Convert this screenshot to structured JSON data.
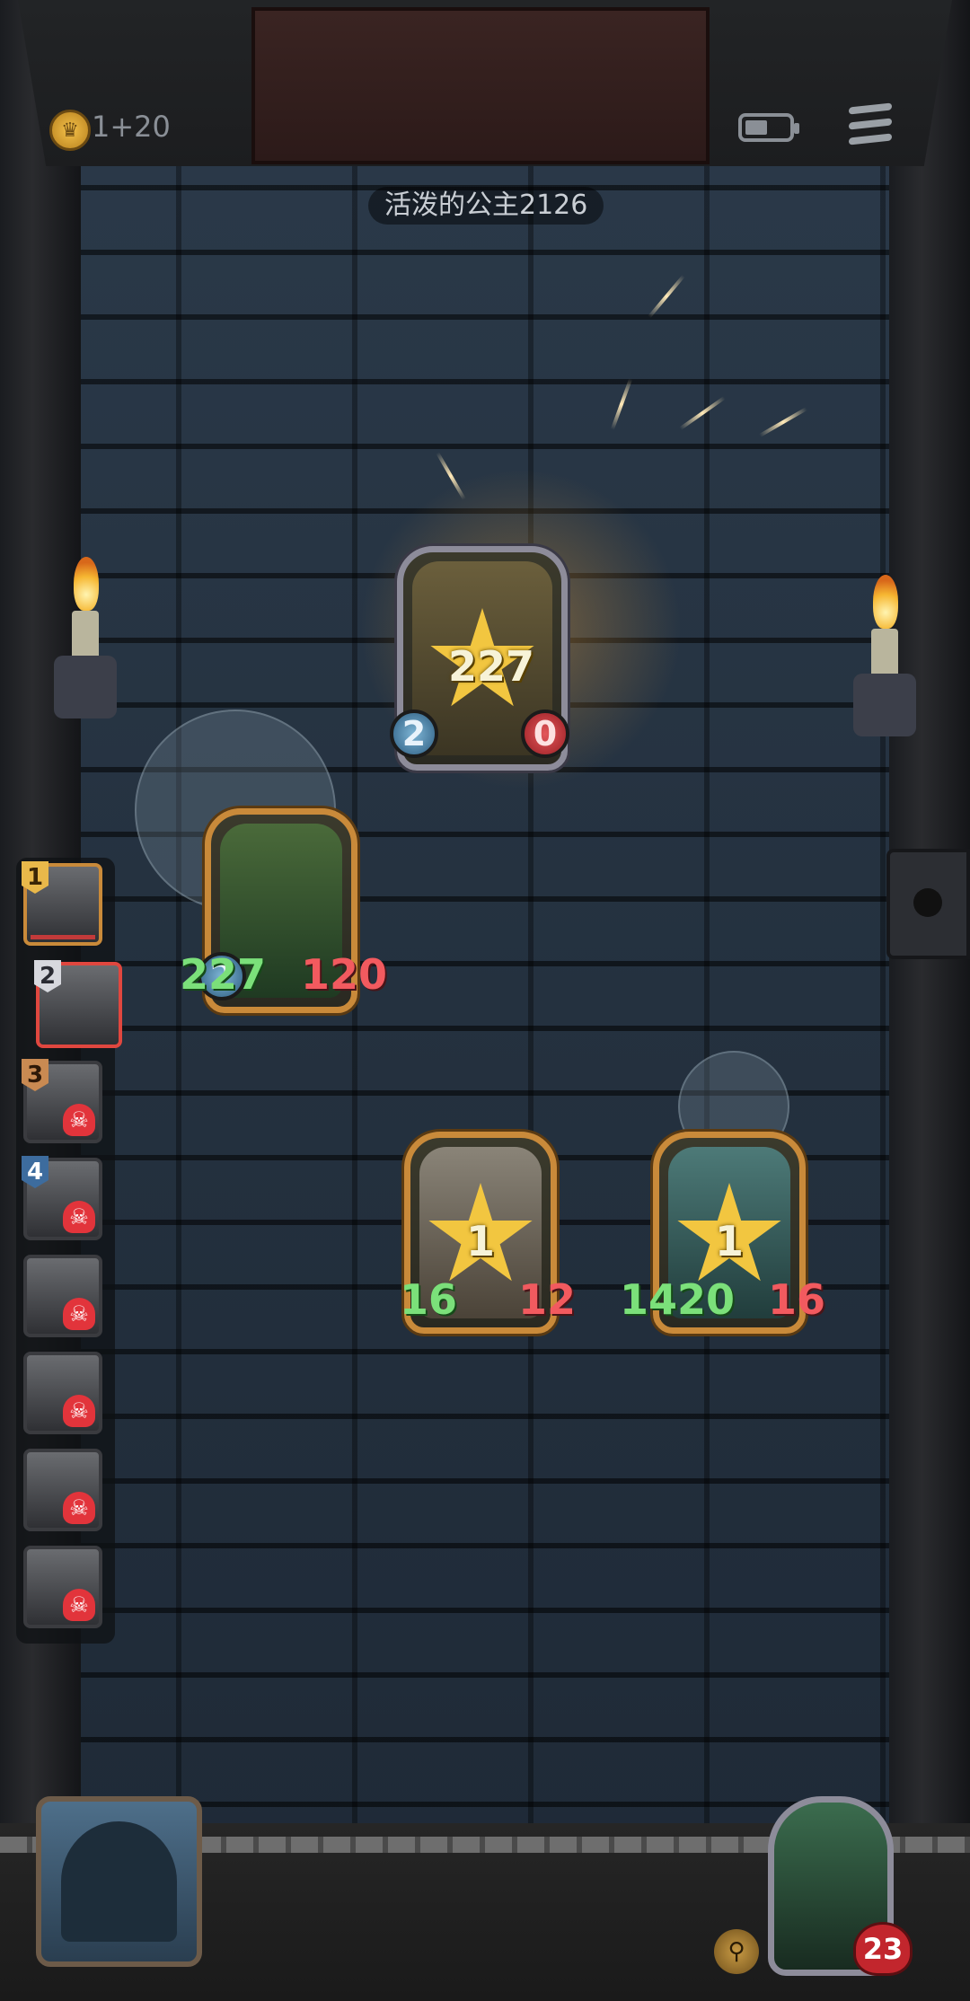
{
  "header": {
    "gold_text": "1+20",
    "opponent_name": "活泼的公主2126"
  },
  "icons": {
    "gold": "crown-coin-icon",
    "battery": "battery-icon",
    "menu": "menu-icon",
    "torch": "torch-icon",
    "dead": "skull-icon",
    "bell": "bell-icon",
    "health": "heart-icon"
  },
  "opponent_card": {
    "star_value": "227",
    "blue_stat": "2",
    "red_stat": "0"
  },
  "board_cards": [
    {
      "star_value": "",
      "blue_stat": "2",
      "attack_label": "227",
      "health_label": "120"
    },
    {
      "star_value": "1",
      "attack_label": "16",
      "health_label": "12"
    },
    {
      "star_value": "1",
      "attack_label": "1420",
      "health_label": "16"
    }
  ],
  "order_panel": {
    "slots": [
      {
        "number": "1",
        "badge": "gold",
        "state": "alive"
      },
      {
        "number": "2",
        "badge": "silver",
        "state": "active"
      },
      {
        "number": "3",
        "badge": "bronze",
        "state": "dead"
      },
      {
        "number": "4",
        "badge": "blue",
        "state": "dead"
      },
      {
        "number": "",
        "badge": "",
        "state": "dead"
      },
      {
        "number": "",
        "badge": "",
        "state": "dead"
      },
      {
        "number": "",
        "badge": "",
        "state": "dead"
      },
      {
        "number": "",
        "badge": "",
        "state": "dead"
      }
    ]
  },
  "player": {
    "health": "23"
  },
  "colors": {
    "gold_frame": "#c98a3a",
    "silver_frame": "#8d8c9a",
    "attack_green": "#7be07a",
    "health_red": "#f25a5f",
    "wall": "#2b3a4a"
  }
}
